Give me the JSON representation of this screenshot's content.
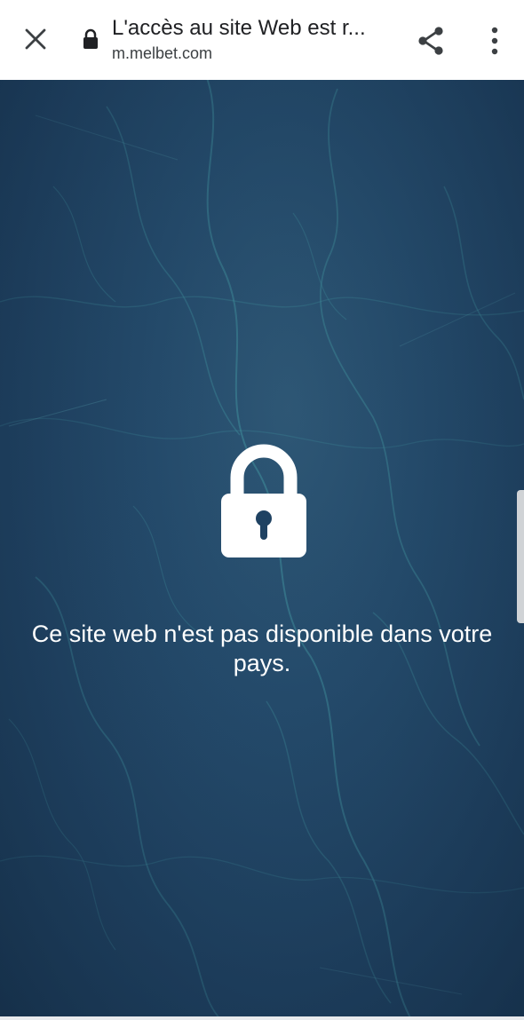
{
  "toolbar": {
    "title": "L'accès au site Web est r...",
    "url": "m.melbet.com",
    "close_icon": "close-icon",
    "lock_icon": "lock-icon",
    "share_icon": "share-icon",
    "menu_icon": "more-vert-icon"
  },
  "main": {
    "lock_icon": "padlock-icon",
    "message": "Ce site web n'est pas disponible dans votre pays."
  },
  "colors": {
    "toolbar_bg": "#ffffff",
    "content_bg": "#1f4262",
    "map_lines": "#3a8a99",
    "text": "#ffffff"
  }
}
